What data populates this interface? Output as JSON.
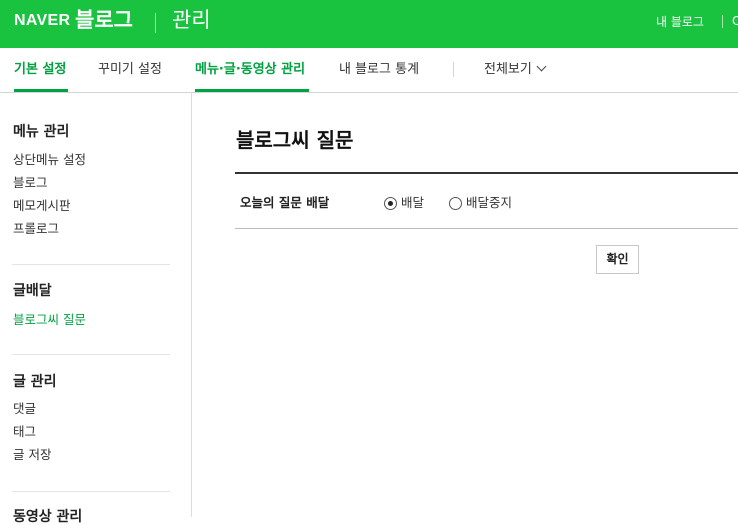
{
  "header": {
    "logo_naver": "NAVER",
    "logo_blog": "블로그",
    "section_title": "관리",
    "my_blog_link": "내 블로그",
    "cut_off_link": "O"
  },
  "tabs": [
    {
      "label": "기본 설정",
      "active": true
    },
    {
      "label": "꾸미기 설정",
      "active": false
    },
    {
      "label": "메뉴·글·동영상 관리",
      "active": true
    },
    {
      "label": "내 블로그 통계",
      "active": false
    },
    {
      "label": "전체보기",
      "active": false
    }
  ],
  "sidebar": {
    "groups": [
      {
        "title": "메뉴 관리",
        "items": [
          "상단메뉴 설정",
          "블로그",
          "메모게시판",
          "프롤로그"
        ]
      },
      {
        "title": "글배달",
        "items": [
          "블로그씨 질문"
        ]
      },
      {
        "title": "글 관리",
        "items": [
          "댓글",
          "태그",
          "글 저장"
        ]
      },
      {
        "title": "동영상 관리",
        "items": []
      }
    ],
    "active_item": "블로그씨 질문"
  },
  "main": {
    "title": "블로그씨 질문",
    "setting_label": "오늘의 질문 배달",
    "options": [
      {
        "label": "배달",
        "checked": true
      },
      {
        "label": "배달중지",
        "checked": false
      }
    ],
    "confirm_label": "확인"
  },
  "colors": {
    "brand_green": "#19c33f",
    "active_text_green": "#00a140"
  }
}
